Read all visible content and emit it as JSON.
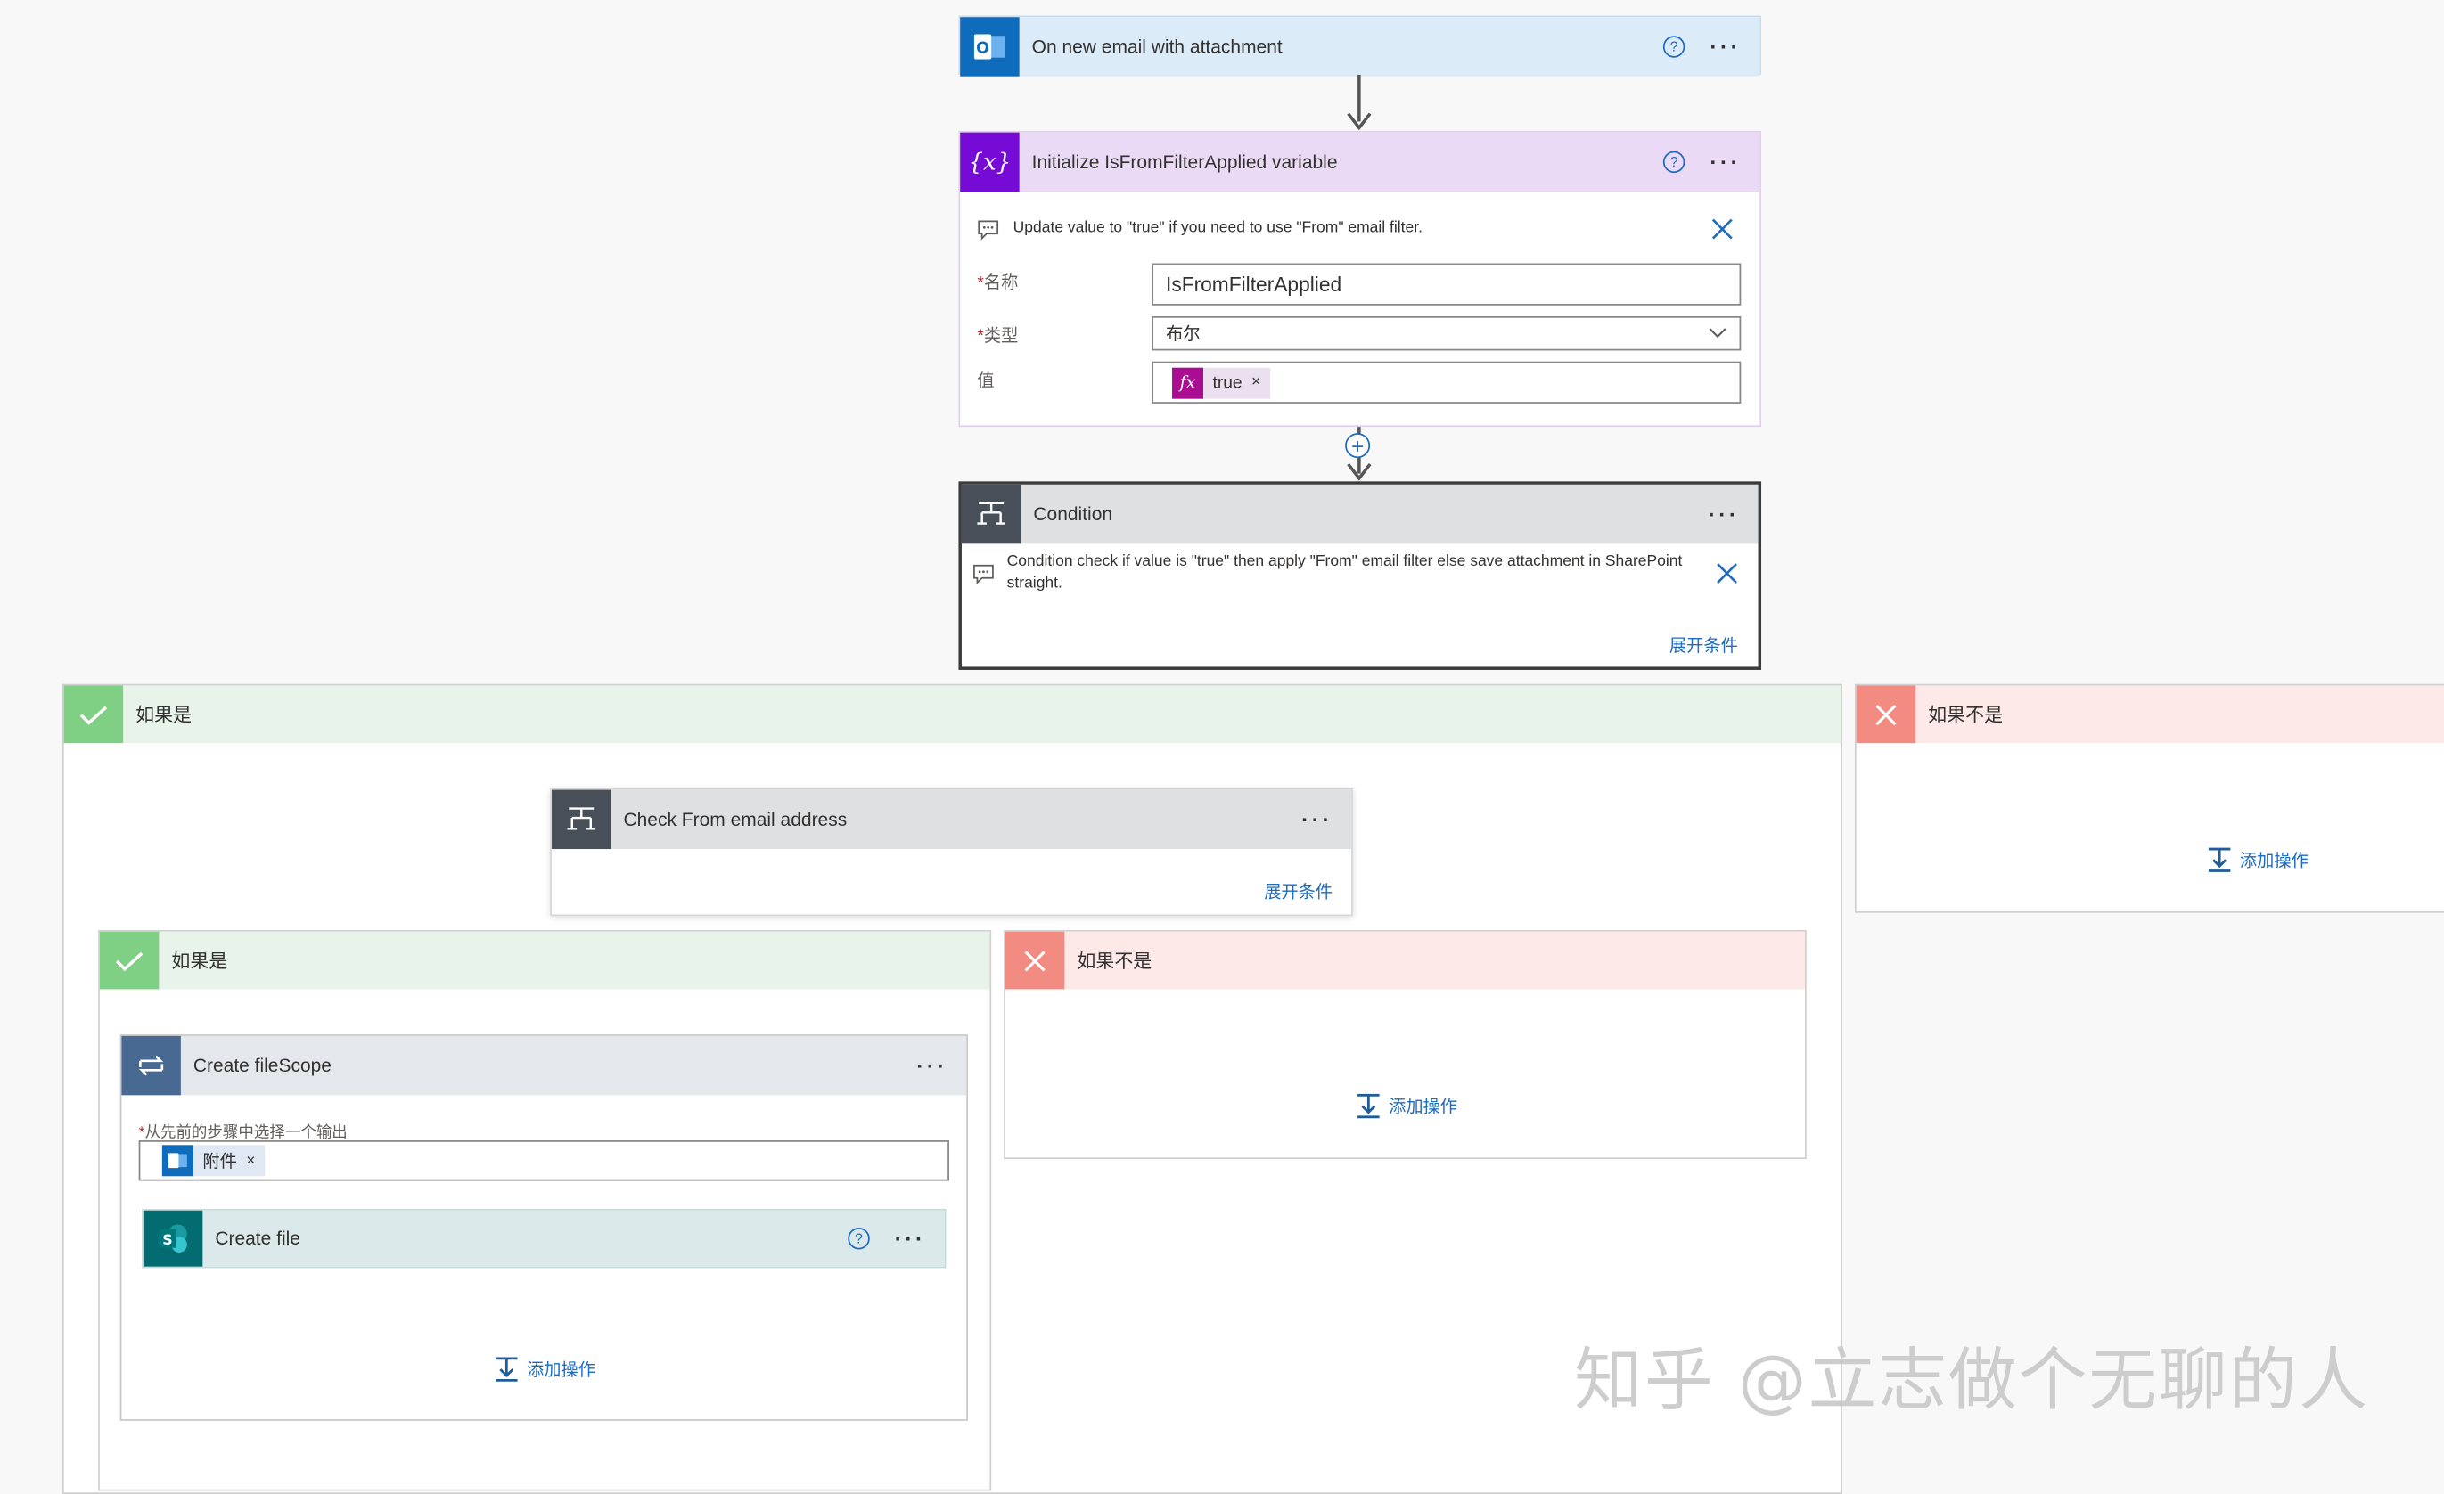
{
  "trigger": {
    "title": "On new email with attachment",
    "icon": "outlook-icon",
    "help_glyph": "?",
    "menu_glyph": "···"
  },
  "init_var": {
    "title": "Initialize IsFromFilterApplied variable",
    "icon": "variable-icon",
    "icon_glyph": "{x}",
    "help_glyph": "?",
    "menu_glyph": "···",
    "comment": "Update value to \"true\" if you need to use \"From\" email filter.",
    "name_label": "名称",
    "name_value": "IsFromFilterApplied",
    "type_label": "类型",
    "type_value": "布尔",
    "value_label": "值",
    "value_token": "true",
    "value_token_glyph": "fx",
    "token_remove": "×",
    "required_mark": "*"
  },
  "condition": {
    "title": "Condition",
    "menu_glyph": "···",
    "comment": "Condition check if value is \"true\" then apply \"From\" email filter else save attachment in SharePoint straight.",
    "expand_link": "展开条件"
  },
  "branch_yes": {
    "title": "如果是"
  },
  "branch_no": {
    "title": "如果不是",
    "add_action": "添加操作"
  },
  "check_from": {
    "title": "Check From email address",
    "menu_glyph": "···",
    "expand_link": "展开条件"
  },
  "inner_yes": {
    "title": "如果是"
  },
  "inner_no": {
    "title": "如果不是",
    "add_action": "添加操作"
  },
  "create_scope": {
    "title": "Create fileScope",
    "menu_glyph": "···",
    "select_label": "从先前的步骤中选择一个输出",
    "required_mark": "*",
    "attachment_token": "附件",
    "token_remove": "×",
    "add_action": "添加操作"
  },
  "create_file": {
    "title": "Create file",
    "icon": "sharepoint-icon",
    "help_glyph": "?",
    "menu_glyph": "···"
  },
  "plus_glyph": "+",
  "watermark": "知乎 @立志做个无聊的人",
  "colors": {
    "outlook_blue": "#0f6cbd",
    "trigger_head": "#dcebf8",
    "variable_purple": "#770bd6",
    "variable_head": "#ebdaf6",
    "condition_dark": "#484f58",
    "condition_head": "#dfe0e2",
    "yes_green": "#7fcf84",
    "no_red": "#f28b82",
    "link_blue": "#1f6bbf",
    "scope_blue": "#486991",
    "sharepoint_teal": "#036c70"
  }
}
